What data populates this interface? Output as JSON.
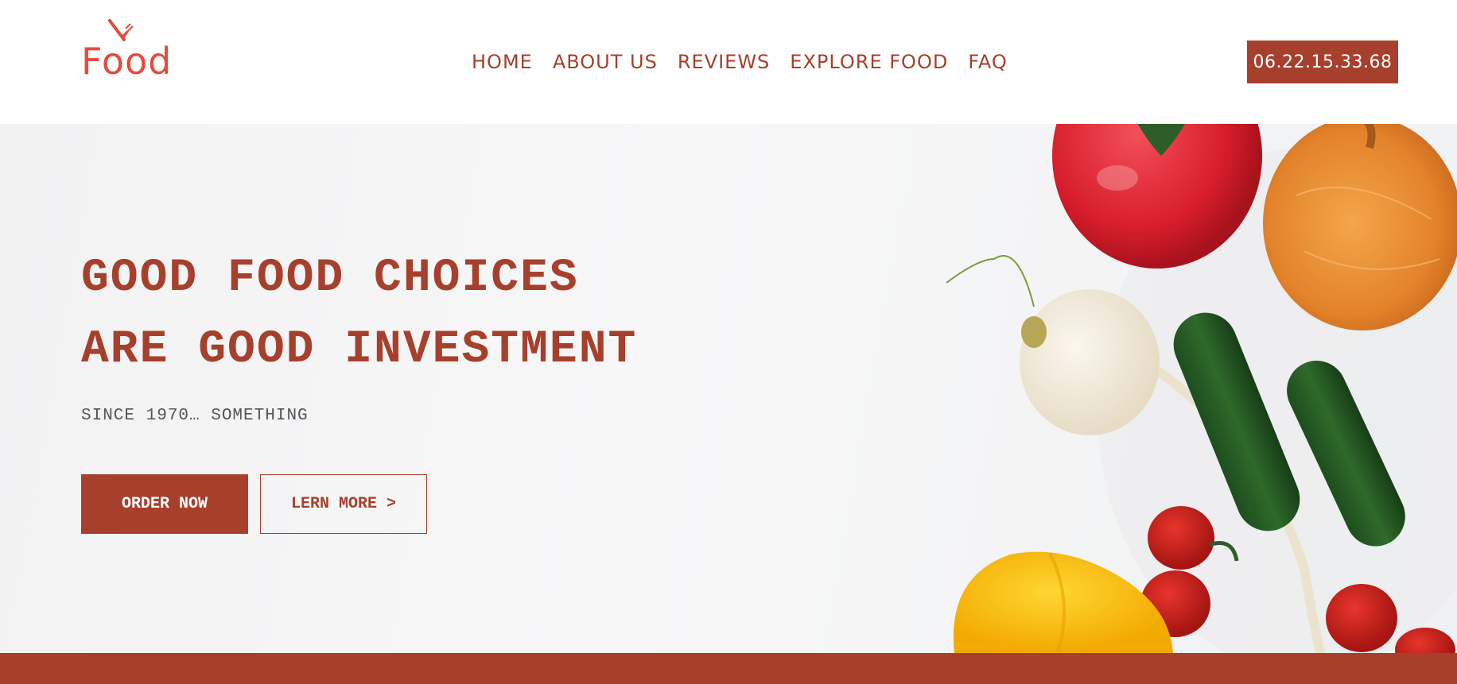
{
  "logo": {
    "text": "Food"
  },
  "nav": {
    "items": [
      {
        "label": "HOME"
      },
      {
        "label": "ABOUT US"
      },
      {
        "label": "REVIEWS"
      },
      {
        "label": "EXPLORE FOOD"
      },
      {
        "label": "FAQ"
      }
    ]
  },
  "phone": {
    "label": "06.22.15.33.68"
  },
  "hero": {
    "headline_line1": "GOOD FOOD CHOICES",
    "headline_line2": "ARE GOOD INVESTMENT",
    "tagline": "SINCE 1970… SOMETHING",
    "order_label": "ORDER NOW",
    "learn_label": "LERN MORE >"
  },
  "colors": {
    "accent": "#a6402c",
    "logo": "#e24d3d",
    "background": "#f4f4f5"
  }
}
